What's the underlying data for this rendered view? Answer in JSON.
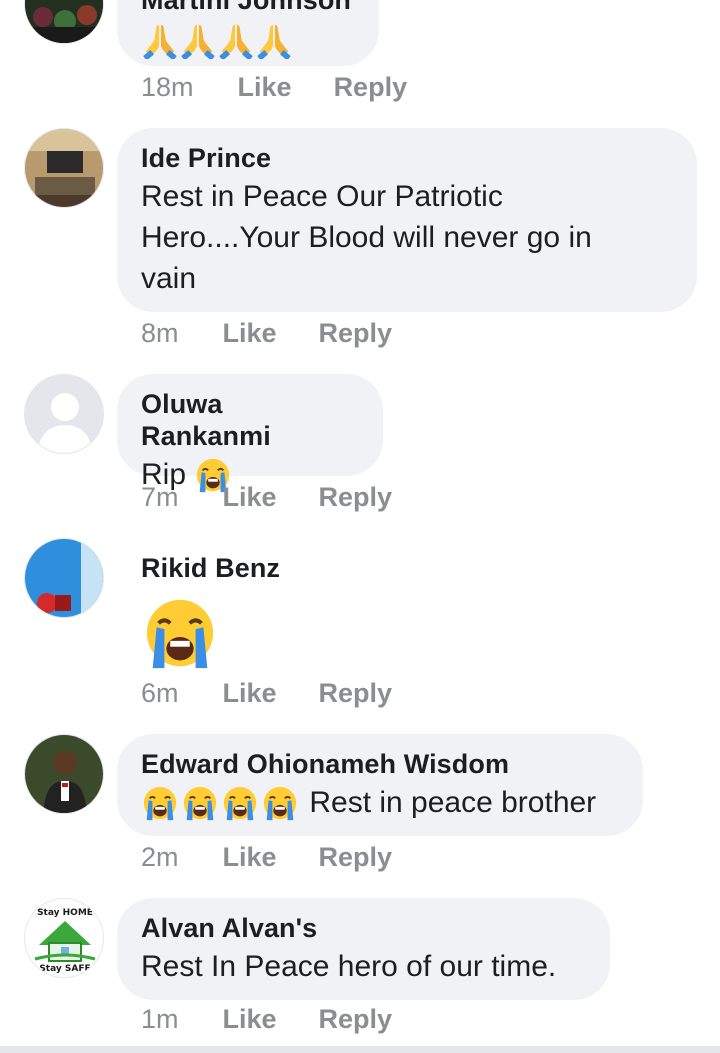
{
  "colors": {
    "bubble": "#f0f2f5",
    "meta": "#8a8d91",
    "text": "#1c1e21"
  },
  "comments": [
    {
      "name": "Martini Johnson",
      "emoji": [
        "folded-hands-icon",
        "folded-hands-icon",
        "folded-hands-icon",
        "folded-hands-icon"
      ],
      "time": "18m",
      "like": "Like",
      "reply": "Reply"
    },
    {
      "name": "Ide Prince",
      "text_lines": [
        "Rest in Peace Our Patriotic",
        "Hero....Your Blood will never go in",
        "vain"
      ],
      "time": "8m",
      "like": "Like",
      "reply": "Reply"
    },
    {
      "name": "Oluwa Rankanmi",
      "text": "Rip",
      "emoji": [
        "loudly-crying-face-icon"
      ],
      "time": "7m",
      "like": "Like",
      "reply": "Reply"
    },
    {
      "name": "Rikid Benz",
      "emoji": [
        "loudly-crying-face-icon"
      ],
      "time": "6m",
      "like": "Like",
      "reply": "Reply"
    },
    {
      "name": "Edward Ohionameh Wisdom",
      "text": "Rest in peace brother",
      "emoji": [
        "loudly-crying-face-icon",
        "loudly-crying-face-icon",
        "loudly-crying-face-icon",
        "loudly-crying-face-icon"
      ],
      "time": "2m",
      "like": "Like",
      "reply": "Reply"
    },
    {
      "name": "Alvan Alvan's",
      "text": "Rest In Peace hero of our time.",
      "avatar_text_top": "Stay HOME",
      "avatar_text_bottom": "Stay SAFE",
      "time": "1m",
      "like": "Like",
      "reply": "Reply"
    }
  ]
}
